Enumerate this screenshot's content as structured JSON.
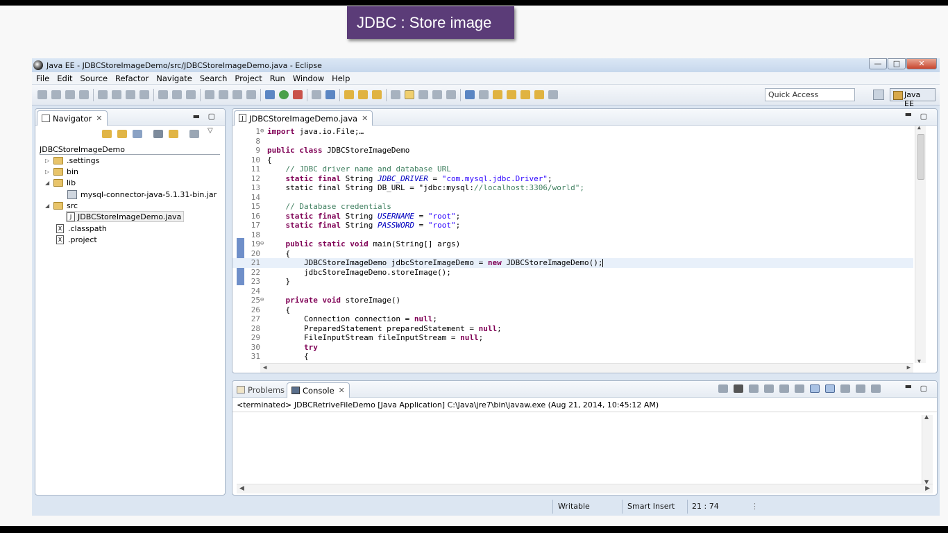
{
  "slide": {
    "title": "JDBC : Store image"
  },
  "window": {
    "title": "Java EE - JDBCStoreImageDemo/src/JDBCStoreImageDemo.java - Eclipse",
    "controls": {
      "minimize": "—",
      "maximize": "□",
      "close": "✕"
    }
  },
  "menu": [
    "File",
    "Edit",
    "Source",
    "Refactor",
    "Navigate",
    "Search",
    "Project",
    "Run",
    "Window",
    "Help"
  ],
  "toolbar": {
    "quick_access": "Quick Access",
    "perspective": "Java EE"
  },
  "navigator": {
    "tab_label": "Navigator",
    "project": "JDBCStoreImageDemo",
    "items": [
      {
        "label": ".settings",
        "type": "folder",
        "expanded": false
      },
      {
        "label": "bin",
        "type": "folder",
        "expanded": false
      },
      {
        "label": "lib",
        "type": "folder",
        "expanded": true
      },
      {
        "label": "mysql-connector-java-5.1.31-bin.jar",
        "type": "jar"
      },
      {
        "label": "src",
        "type": "folder",
        "expanded": true
      },
      {
        "label": "JDBCStoreImageDemo.java",
        "type": "java",
        "selected": true
      },
      {
        "label": ".classpath",
        "type": "xml"
      },
      {
        "label": ".project",
        "type": "xml"
      }
    ]
  },
  "editor": {
    "tab_label": "JDBCStoreImageDemo.java",
    "lines": [
      {
        "n": "1",
        "code": "import java.io.File;…"
      },
      {
        "n": "8",
        "code": ""
      },
      {
        "n": "9",
        "code": "public class JDBCStoreImageDemo"
      },
      {
        "n": "10",
        "code": "{"
      },
      {
        "n": "11",
        "code": "    // JDBC driver name and database URL"
      },
      {
        "n": "12",
        "code": "    static final String JDBC_DRIVER = \"com.mysql.jdbc.Driver\";"
      },
      {
        "n": "13",
        "code": "    static final String DB_URL = \"jdbc:mysql://localhost:3306/world\";"
      },
      {
        "n": "14",
        "code": ""
      },
      {
        "n": "15",
        "code": "    // Database credentials"
      },
      {
        "n": "16",
        "code": "    static final String USERNAME = \"root\";"
      },
      {
        "n": "17",
        "code": "    static final String PASSWORD = \"root\";"
      },
      {
        "n": "18",
        "code": ""
      },
      {
        "n": "19",
        "code": "    public static void main(String[] args)"
      },
      {
        "n": "20",
        "code": "    {"
      },
      {
        "n": "21",
        "code": "        JDBCStoreImageDemo jdbcStoreImageDemo = new JDBCStoreImageDemo();"
      },
      {
        "n": "22",
        "code": "        jdbcStoreImageDemo.storeImage();"
      },
      {
        "n": "23",
        "code": "    }"
      },
      {
        "n": "24",
        "code": ""
      },
      {
        "n": "25",
        "code": "    private void storeImage()"
      },
      {
        "n": "26",
        "code": "    {"
      },
      {
        "n": "27",
        "code": "        Connection connection = null;"
      },
      {
        "n": "28",
        "code": "        PreparedStatement preparedStatement = null;"
      },
      {
        "n": "29",
        "code": "        FileInputStream fileInputStream = null;"
      },
      {
        "n": "30",
        "code": "        try"
      },
      {
        "n": "31",
        "code": "        {"
      }
    ]
  },
  "bottom_panel": {
    "tabs": [
      "Problems",
      "Console"
    ],
    "console_header": "<terminated> JDBCRetriveFileDemo [Java Application] C:\\Java\\jre7\\bin\\javaw.exe (Aug 21, 2014, 10:45:12 AM)"
  },
  "status": {
    "mode": "Writable",
    "insert": "Smart Insert",
    "position": "21 : 74"
  }
}
